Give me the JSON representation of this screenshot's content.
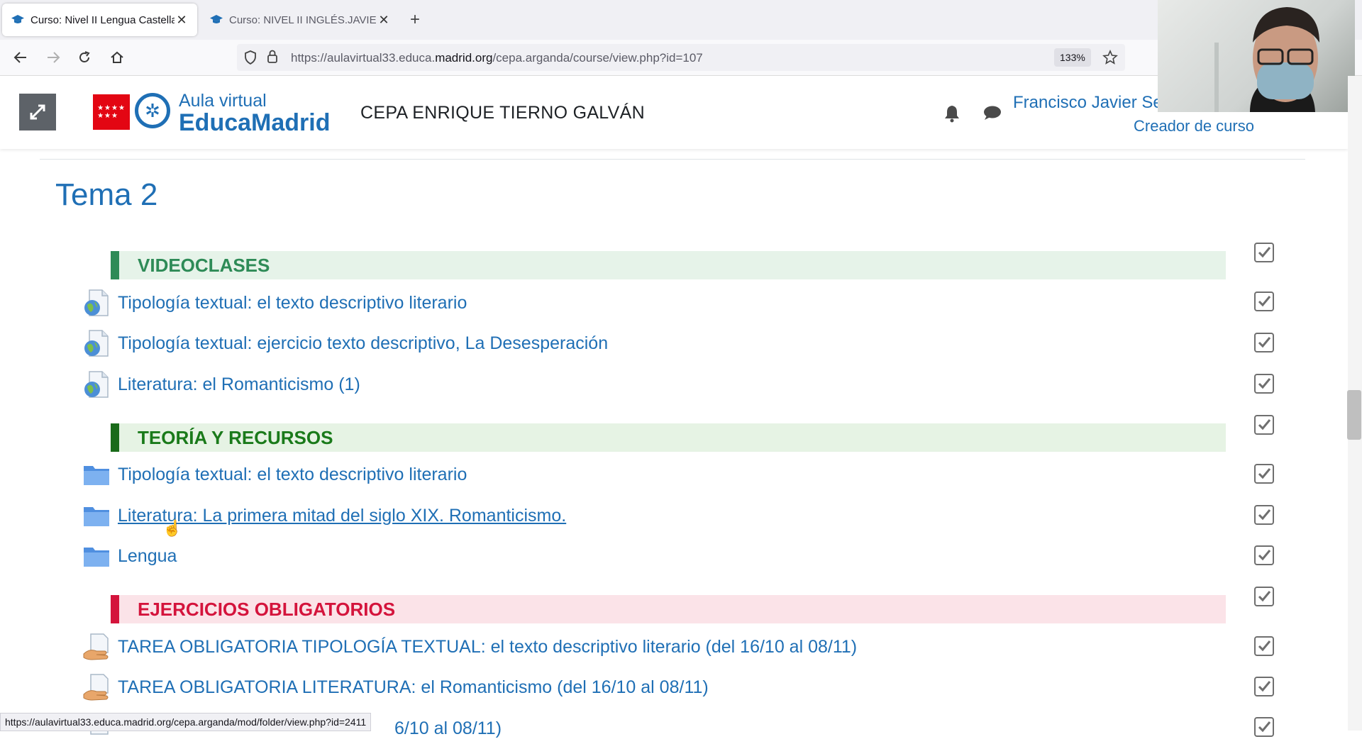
{
  "browser": {
    "tabs": [
      {
        "title": "Curso: Nivel II Lengua Castellan",
        "active": true
      },
      {
        "title": "Curso: NIVEL II INGLÉS.JAVIER",
        "active": false
      }
    ],
    "url_prefix": "https://aulavirtual33.educa.",
    "url_domain": "madrid.org",
    "url_path": "/cepa.arganda/course/view.php?id=107",
    "zoom": "133%",
    "status_url": "https://aulavirtual33.educa.madrid.org/cepa.arganda/mod/folder/view.php?id=2411"
  },
  "header": {
    "logo_line1": "Aula virtual",
    "logo_line2": "EducaMadrid",
    "site_name": "CEPA ENRIQUE TIERNO GALVÁN",
    "user_name": "Francisco Javier Se",
    "user_role": "Creador de curso"
  },
  "section": {
    "title": "Tema 2",
    "labels": [
      {
        "text": "VIDEOCLASES",
        "color": "#2e8b57",
        "bg": "#e6f3e9",
        "bar": "#2e8b57"
      },
      {
        "text": "TEORÍA Y RECURSOS",
        "color": "#1a7a1a",
        "bg": "#e6f3e4",
        "bar": "#1a6b1a"
      },
      {
        "text": "EJERCICIOS OBLIGATORIOS",
        "color": "#d4143c",
        "bg": "#fbe3e8",
        "bar": "#d4143c"
      }
    ],
    "activities": [
      {
        "text": "Tipología textual: el texto descriptivo literario",
        "icon": "url-icon"
      },
      {
        "text": "Tipología textual: ejercicio texto descriptivo, La Desesperación",
        "icon": "url-icon"
      },
      {
        "text": "Literatura: el Romanticismo (1)",
        "icon": "url-icon"
      },
      {
        "text": "Tipología textual: el texto descriptivo literario",
        "icon": "folder-icon"
      },
      {
        "text": "Literatura: La primera mitad del siglo XIX. Romanticismo.",
        "icon": "folder-icon",
        "hover": true
      },
      {
        "text": "Lengua",
        "icon": "folder-icon"
      },
      {
        "text": "TAREA OBLIGATORIA TIPOLOGÍA TEXTUAL: el texto descriptivo literario (del 16/10 al 08/11)",
        "icon": "assignment-icon"
      },
      {
        "text": "TAREA OBLIGATORIA LITERATURA: el Romanticismo (del 16/10 al 08/11)",
        "icon": "assignment-icon"
      },
      {
        "text": "6/10 al 08/11)",
        "icon": "assignment-icon"
      }
    ]
  }
}
